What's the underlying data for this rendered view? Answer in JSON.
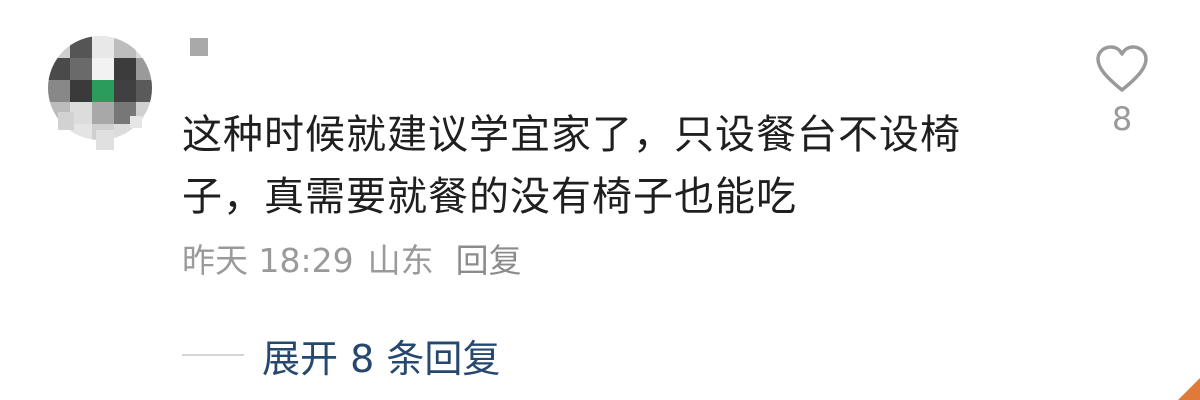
{
  "comment": {
    "text": "这种时候就建议学宜家了，只设餐台不设椅子，真需要就餐的没有椅子也能吃",
    "date": "昨天 18:29",
    "location": "山东",
    "reply_label": "回复",
    "like_count": "8",
    "like_icon": "heart-outline-icon"
  },
  "expand": {
    "label": "展开 8 条回复"
  },
  "colors": {
    "text": "#1f1f1f",
    "meta": "#9a9a9a",
    "link": "#26486f"
  }
}
